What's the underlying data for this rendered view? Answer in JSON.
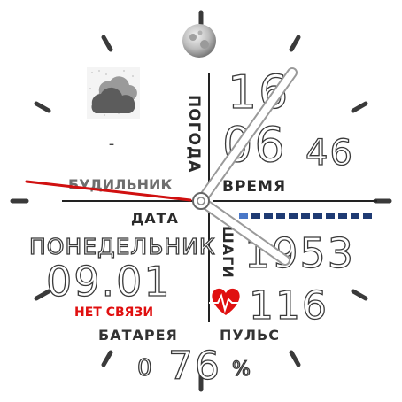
{
  "weather": {
    "label": "ПОГОДА",
    "temperature": "-",
    "icon": "cloud-icon"
  },
  "time": {
    "label": "ВРЕМЯ",
    "hour": "16",
    "minute": "06",
    "seconds": "46"
  },
  "alarm": {
    "label": "БУДИЛЬНИК"
  },
  "date": {
    "label": "ДАТА",
    "weekday": "ПОНЕДЕЛЬНИК",
    "value": "09.01"
  },
  "connection": {
    "status": "НЕТ СВЯЗИ"
  },
  "steps": {
    "label": "ШАГИ",
    "count": "1953",
    "progress_segments_filled": 1,
    "progress_segments_total": 11
  },
  "battery": {
    "label": "БАТАРЕЯ",
    "value": "76",
    "unit": "%",
    "icon_text": "0"
  },
  "heart": {
    "label": "ПУЛЬС",
    "value": "116",
    "icon": "heart-icon"
  },
  "moon": {
    "icon": "moon-icon"
  },
  "colors": {
    "accent_red": "#e01010",
    "steps_blue": "#1f3b73",
    "steps_active": "#4a78c8"
  }
}
